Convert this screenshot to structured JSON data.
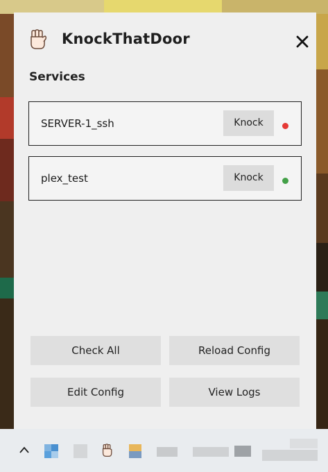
{
  "app": {
    "title": "KnockThatDoor",
    "logo_icon": "raised-fist-icon",
    "close_icon": "close-icon"
  },
  "services": {
    "heading": "Services",
    "items": [
      {
        "name": "SERVER-1_ssh",
        "button_label": "Knock",
        "status": "offline",
        "status_color": "#e53935"
      },
      {
        "name": "plex_test",
        "button_label": "Knock",
        "status": "online",
        "status_color": "#43a047"
      }
    ]
  },
  "actions": {
    "check_all": "Check All",
    "reload_config": "Reload Config",
    "edit_config": "Edit Config",
    "view_logs": "View Logs"
  },
  "taskbar": {
    "overflow_icon": "chevron-up-icon",
    "tray_icons": [
      "network-icon",
      "app-icon",
      "raised-fist-icon",
      "folder-icon"
    ]
  }
}
